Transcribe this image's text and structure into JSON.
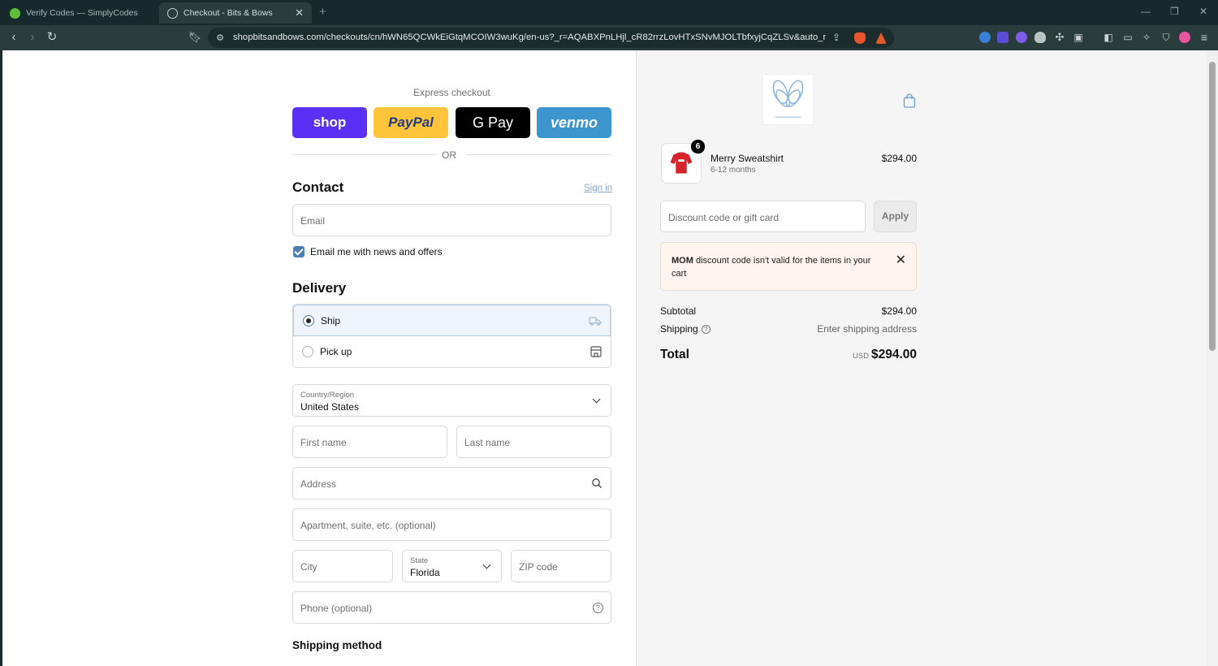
{
  "browser": {
    "tabs": [
      {
        "title": "Verify Codes — SimplyCodes",
        "active": false
      },
      {
        "title": "Checkout - Bits & Bows",
        "active": true
      }
    ],
    "url": "shopbitsandbows.com/checkouts/cn/hWN65QCWkEiGtqMCOIW3wuKg/en-us?_r=AQABXPnLHjl_cR82rrzLovHTxSNvMJOLTbfxyjCqZLSv&auto_redirect...",
    "accent_color": "#2b3c3d"
  },
  "express": {
    "label": "Express checkout",
    "buttons": {
      "shop": "shop",
      "paypal": "PayPal",
      "gpay": "G Pay",
      "venmo": "venmo"
    },
    "or_text": "OR"
  },
  "contact": {
    "heading": "Contact",
    "sign_in": "Sign in",
    "email_placeholder": "Email",
    "newsletter_label": "Email me with news and offers",
    "newsletter_checked": true
  },
  "delivery": {
    "heading": "Delivery",
    "options": [
      {
        "label": "Ship",
        "selected": true,
        "icon": "truck-icon"
      },
      {
        "label": "Pick up",
        "selected": false,
        "icon": "store-icon"
      }
    ],
    "country_label": "Country/Region",
    "country_value": "United States",
    "first_name_placeholder": "First name",
    "last_name_placeholder": "Last name",
    "address_placeholder": "Address",
    "apartment_placeholder": "Apartment, suite, etc. (optional)",
    "city_placeholder": "City",
    "state_label": "State",
    "state_value": "Florida",
    "zip_placeholder": "ZIP code",
    "phone_placeholder": "Phone (optional)"
  },
  "shipping_method": {
    "heading": "Shipping method"
  },
  "summary": {
    "item": {
      "name": "Merry Sweatshirt",
      "variant": "6-12 months",
      "price": "$294.00",
      "quantity": "6"
    },
    "discount_placeholder": "Discount code or gift card",
    "apply_label": "Apply",
    "error": {
      "code": "MOM",
      "message": "discount code isn't valid for the items in your cart"
    },
    "subtotal_label": "Subtotal",
    "subtotal_value": "$294.00",
    "shipping_label": "Shipping",
    "shipping_value": "Enter shipping address",
    "total_label": "Total",
    "total_currency": "USD",
    "total_value": "$294.00"
  }
}
